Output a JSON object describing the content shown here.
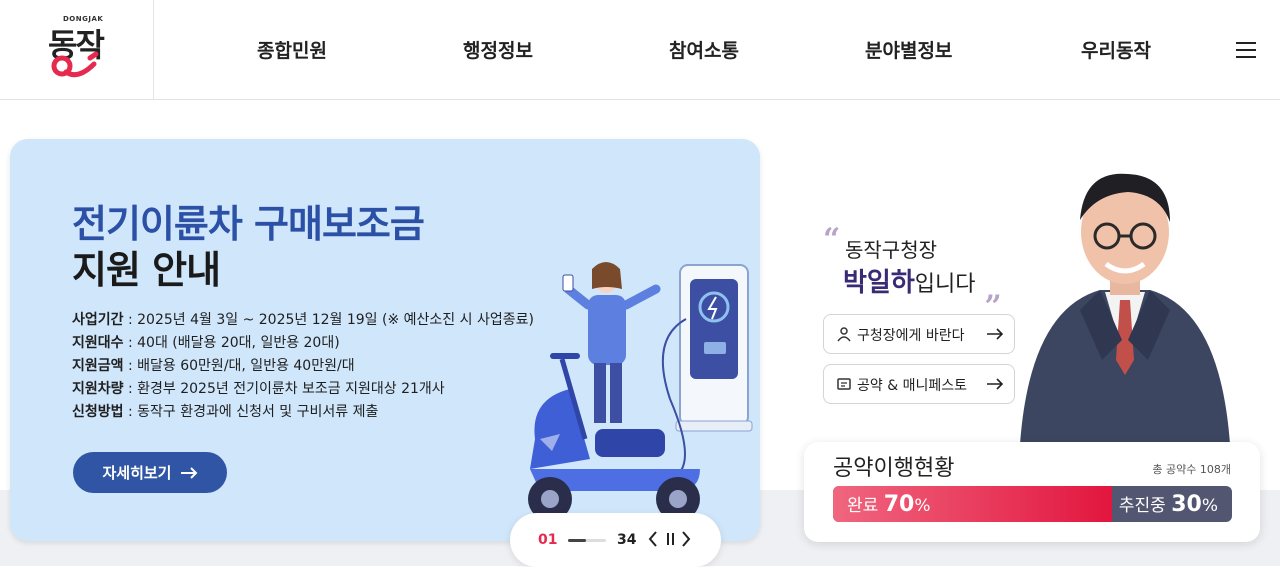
{
  "header": {
    "logo_small": "DONGJAK",
    "logo_text": "동작",
    "nav": [
      "종합민원",
      "행정정보",
      "참여소통",
      "분야별정보",
      "우리동작"
    ]
  },
  "banner": {
    "title_line1": "전기이륜차 구매보조금",
    "title_line2": "지원 안내",
    "lines": [
      {
        "label": "사업기간",
        "value": " : 2025년 4월 3일 ~ 2025년 12월 19일 (※ 예산소진 시 사업종료)"
      },
      {
        "label": "지원대수",
        "value": " : 40대 (배달용 20대, 일반용 20대)"
      },
      {
        "label": "지원금액",
        "value": " : 배달용 60만원/대, 일반용 40만원/대"
      },
      {
        "label": "지원차량",
        "value": " : 환경부 2025년 전기이륜차 보조금 지원대상 21개사"
      },
      {
        "label": "신청방법",
        "value": " : 동작구 환경과에 신청서 및 구비서류 제출"
      }
    ],
    "detail_button": "자세히보기"
  },
  "pager": {
    "current": "01",
    "total": "34",
    "progress": 0.5
  },
  "mayor": {
    "line1": "동작구청장",
    "name": "박일하",
    "suffix": "입니다",
    "quote_open": "“",
    "quote_close": "„"
  },
  "side_buttons": [
    "구청장에게 바란다",
    "공약 & 매니페스토"
  ],
  "pledge": {
    "title": "공약이행현황",
    "count": "총 공약수 108개",
    "done_label": "완료",
    "done_value": "70",
    "progress_label": "추진중",
    "progress_value": "30",
    "percent_sign": "%",
    "done_fraction": 0.7
  },
  "colors": {
    "accent": "#e5294f",
    "brand_blue": "#2f55a4",
    "banner_bg": "#cfe6fb",
    "mayor_name": "#3a2a76"
  }
}
